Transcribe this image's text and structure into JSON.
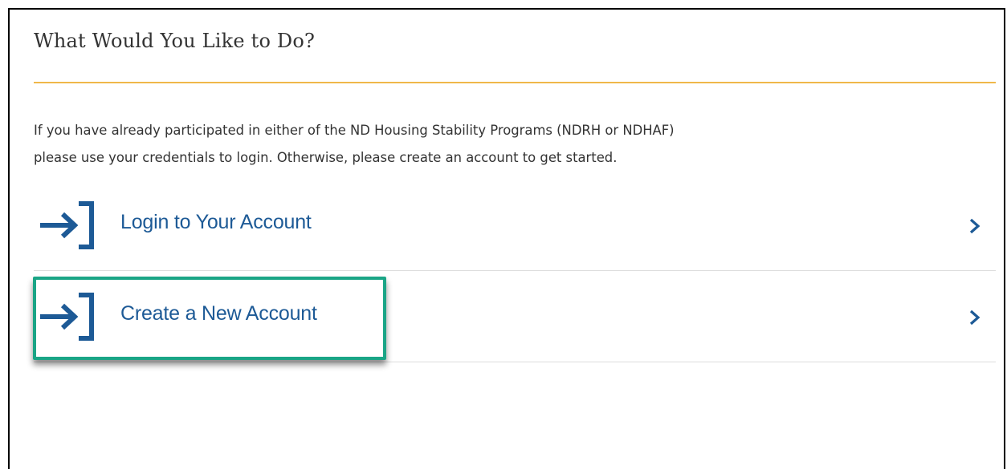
{
  "heading": {
    "title": "What Would You Like to Do?"
  },
  "intro": {
    "line1": "If you have already participated in either of the ND Housing Stability Programs (NDRH or NDHAF)",
    "line2": "please use your credentials to login. Otherwise, please create an account to get started."
  },
  "actions": [
    {
      "label": "Login to Your Account",
      "icon": "login-arrow-icon",
      "chevron": "chevron-right-icon",
      "highlighted": false
    },
    {
      "label": "Create a New Account",
      "icon": "login-arrow-icon",
      "chevron": "chevron-right-icon",
      "highlighted": true
    }
  ],
  "colors": {
    "accent_rule": "#f0b84a",
    "link_blue": "#1d5a96",
    "highlight_green": "#1aa586",
    "text": "#333333",
    "divider": "#dddddd"
  }
}
